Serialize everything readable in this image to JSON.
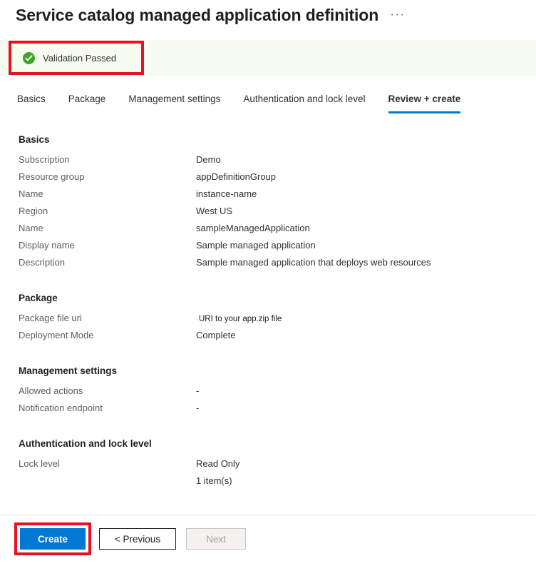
{
  "header": {
    "title": "Service catalog managed application definition",
    "more_options": "···"
  },
  "validation": {
    "text": "Validation Passed",
    "icon": "check-circle-icon",
    "banner_color": "#f6fcf0",
    "icon_color": "#3fa32a",
    "highlight_color": "#e81123"
  },
  "tabs": [
    {
      "label": "Basics",
      "active": false
    },
    {
      "label": "Package",
      "active": false
    },
    {
      "label": "Management settings",
      "active": false
    },
    {
      "label": "Authentication and lock level",
      "active": false
    },
    {
      "label": "Review + create",
      "active": true
    }
  ],
  "sections": [
    {
      "title": "Basics",
      "rows": [
        {
          "label": "Subscription",
          "value": "Demo"
        },
        {
          "label": "Resource group",
          "value": "appDefinitionGroup"
        },
        {
          "label": "Name",
          "value": "instance-name"
        },
        {
          "label": "Region",
          "value": "West US"
        },
        {
          "label": "Name",
          "value": "sampleManagedApplication"
        },
        {
          "label": "Display name",
          "value": "Sample managed application"
        },
        {
          "label": "Description",
          "value": "Sample managed application that deploys web resources"
        }
      ]
    },
    {
      "title": "Package",
      "rows": [
        {
          "label": "Package file uri",
          "value": "URI to your app.zip file",
          "style": "small"
        },
        {
          "label": "Deployment Mode",
          "value": "Complete"
        }
      ]
    },
    {
      "title": "Management settings",
      "rows": [
        {
          "label": "Allowed actions",
          "value": "-"
        },
        {
          "label": "Notification endpoint",
          "value": "-"
        }
      ]
    },
    {
      "title": "Authentication and lock level",
      "rows": [
        {
          "label": "Lock level",
          "value": "Read Only"
        },
        {
          "label": "",
          "value": "1 item(s)"
        }
      ]
    }
  ],
  "footer": {
    "create_label": "Create",
    "previous_label": "< Previous",
    "next_label": "Next",
    "accent_color": "#0078d4"
  }
}
